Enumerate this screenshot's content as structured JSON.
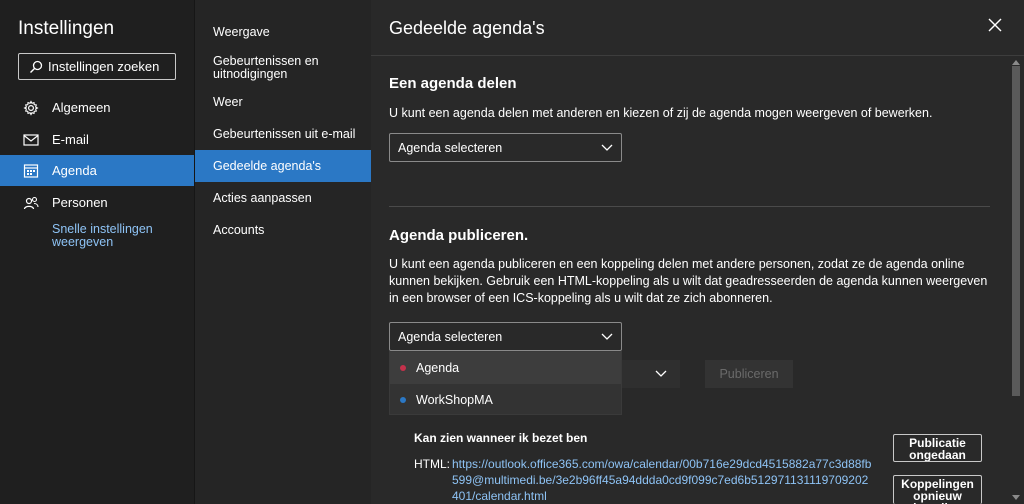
{
  "nav": {
    "title": "Instellingen",
    "search_label": "Instellingen zoeken",
    "items": [
      {
        "label": "Algemeen",
        "icon": "gear-icon"
      },
      {
        "label": "E-mail",
        "icon": "mail-icon"
      },
      {
        "label": "Agenda",
        "icon": "calendar-icon"
      },
      {
        "label": "Personen",
        "icon": "people-icon"
      }
    ],
    "quick_settings": "Snelle instellingen weergeven"
  },
  "subnav": {
    "items": [
      {
        "label": "Weergave"
      },
      {
        "label": "Gebeurtenissen en uitnodigingen"
      },
      {
        "label": "Weer"
      },
      {
        "label": "Gebeurtenissen uit e-mail"
      },
      {
        "label": "Gedeelde agenda's"
      },
      {
        "label": "Acties aanpassen"
      },
      {
        "label": "Accounts"
      }
    ]
  },
  "panel": {
    "title": "Gedeelde agenda's",
    "share": {
      "heading": "Een agenda delen",
      "description": "U kunt een agenda delen met anderen en kiezen of zij de agenda mogen weergeven of bewerken.",
      "select_label": "Agenda selecteren"
    },
    "publish": {
      "heading": "Agenda publiceren.",
      "description": "U kunt een agenda publiceren en een koppeling delen met andere personen, zodat ze de agenda online kunnen bekijken. Gebruik een HTML-koppeling als u wilt dat geadresseerden de agenda kunnen weergeven in een browser of een ICS-koppeling als u wilt dat ze zich abonneren.",
      "select_label": "Agenda selecteren",
      "dropdown_options": [
        {
          "label": "Agenda",
          "color": "#c4314b"
        },
        {
          "label": "WorkShopMA",
          "color": "#2b78c5"
        }
      ],
      "publish_button": "Publiceren",
      "permission_label": "Kan zien wanneer ik bezet ben",
      "html_label": "HTML:",
      "html_url": "https://outlook.office365.com/owa/calendar/00b716e29dcd4515882a77c3d88fb599@multimedi.be/3e2b96ff45a94ddda0cd9f099c7ed6b512971131119709202401/calendar.html",
      "unpublish_button": "Publicatie ongedaan maken",
      "reset_links_button": "Koppelingen opnieuw instellen"
    }
  }
}
